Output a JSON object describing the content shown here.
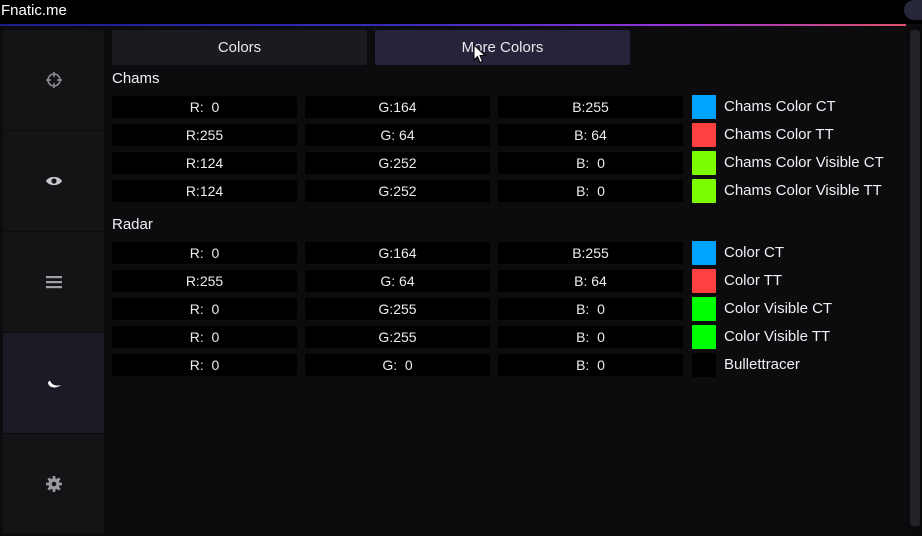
{
  "app": {
    "title": "Fnatic.me"
  },
  "sidebar": {
    "items": [
      {
        "icon": "crosshair-icon"
      },
      {
        "icon": "eye-icon"
      },
      {
        "icon": "menu-icon"
      },
      {
        "icon": "moon-icon",
        "active": true
      },
      {
        "icon": "gear-icon"
      }
    ]
  },
  "tabs": [
    {
      "label": "Colors"
    },
    {
      "label": "More Colors",
      "active": true
    }
  ],
  "chams": {
    "label": "Chams",
    "rows": [
      {
        "r": "R:  0",
        "g": "G:164",
        "b": "B:255",
        "name": "Chams Color CT",
        "color": "#00a4ff"
      },
      {
        "r": "R:255",
        "g": "G: 64",
        "b": "B: 64",
        "name": "Chams Color TT",
        "color": "#ff4040"
      },
      {
        "r": "R:124",
        "g": "G:252",
        "b": "B:  0",
        "name": "Chams Color Visible CT",
        "color": "#7cfc00"
      },
      {
        "r": "R:124",
        "g": "G:252",
        "b": "B:  0",
        "name": "Chams Color Visible TT",
        "color": "#7cfc00"
      }
    ]
  },
  "radar": {
    "label": "Radar",
    "rows": [
      {
        "r": "R:  0",
        "g": "G:164",
        "b": "B:255",
        "name": "Color CT",
        "color": "#00a4ff"
      },
      {
        "r": "R:255",
        "g": "G: 64",
        "b": "B: 64",
        "name": "Color TT",
        "color": "#ff4040"
      },
      {
        "r": "R:  0",
        "g": "G:255",
        "b": "B:  0",
        "name": "Color Visible CT",
        "color": "#00ff00"
      },
      {
        "r": "R:  0",
        "g": "G:255",
        "b": "B:  0",
        "name": "Color Visible TT",
        "color": "#00ff00"
      },
      {
        "r": "R:  0",
        "g": "G:  0",
        "b": "B:  0",
        "name": "Bullettracer",
        "color": "#000000"
      }
    ]
  }
}
